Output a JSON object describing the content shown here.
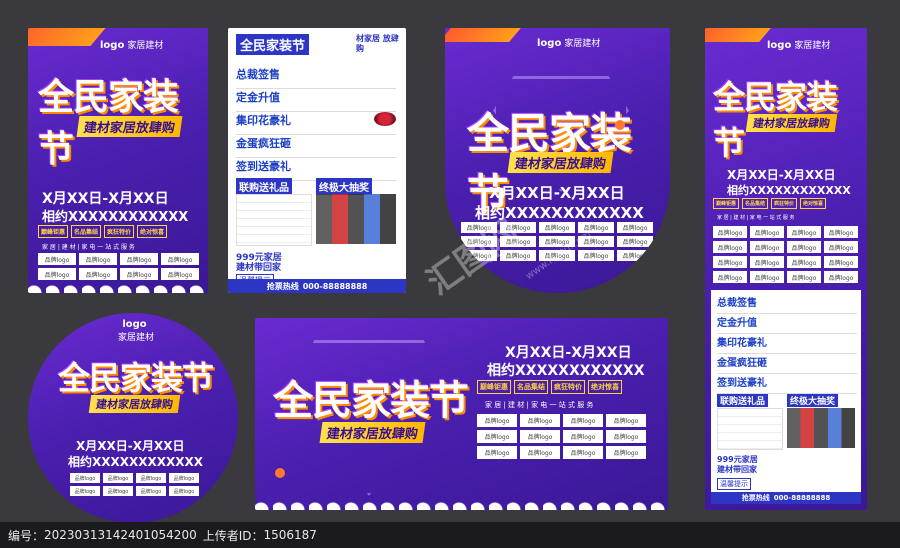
{
  "logo": {
    "mark": "logo",
    "text": "家居建材"
  },
  "title": "全民家装节",
  "subtitle": "建材家居放肆购",
  "date_range": "X月XX日-X月XX日",
  "meet": "相约XXXXXXXXXXXX",
  "tags": [
    "巅峰钜惠",
    "名品集结",
    "疯狂特价",
    "绝对惊喜"
  ],
  "slogan": "家 居 | 建 材 | 家 电   一 站 式 服 务",
  "brand_logo": "品牌logo",
  "flyer": {
    "header_title": "全民家装节",
    "header_side": "材家居 放肆购",
    "sections": [
      "总裁签售",
      "定金升值",
      "集印花豪礼",
      "金蛋疯狂砸",
      "签到送豪礼"
    ],
    "gift_title": "联购送礼品",
    "draw_title": "终极大抽奖",
    "promo_line1": "999元家居",
    "promo_line2": "建材带回家",
    "notice": "温馨提示",
    "hotline_label": "抢票热线",
    "hotline_number": "000-88888888"
  },
  "watermark": {
    "cn": "汇图网",
    "en": "www.huitu.com"
  },
  "footer": {
    "id_label": "编号：",
    "id_value": "20230313142401054200",
    "uploader_label": "上传者ID：",
    "uploader_value": "1506187"
  },
  "colors": {
    "purple": "#4b1fb0",
    "gold": "#ffd23f",
    "orange": "#ff8a00"
  }
}
